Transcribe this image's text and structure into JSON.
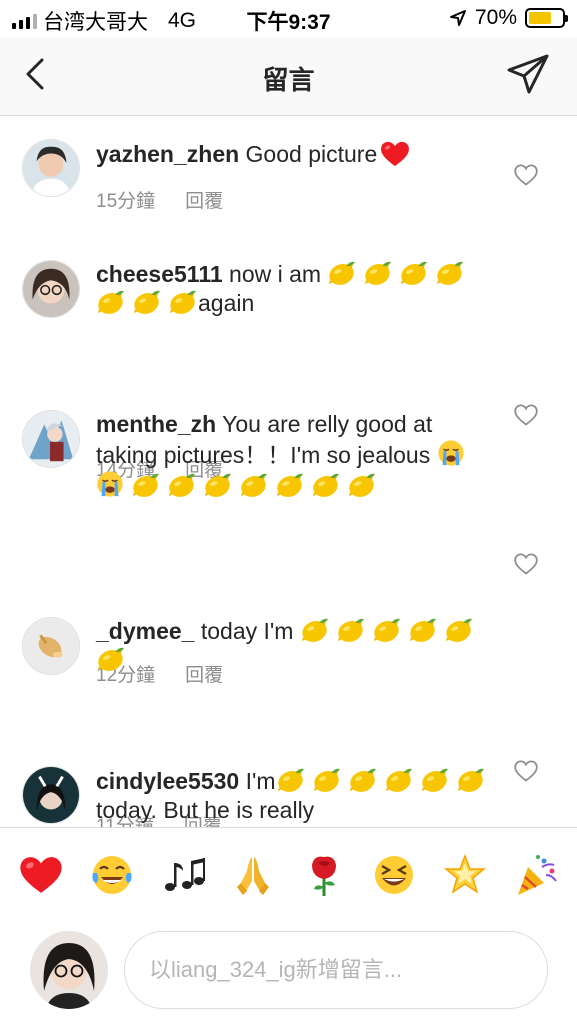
{
  "status_bar": {
    "carrier": "台湾大哥大",
    "network": "4G",
    "time": "下午9:37",
    "battery_percent": 70,
    "battery_label": "70%",
    "icons": [
      "signal-icon",
      "location-arrow-icon",
      "battery-icon"
    ]
  },
  "header": {
    "title": "留言",
    "back_icon": "chevron-left-icon",
    "send_icon": "paper-plane-icon"
  },
  "comments": [
    {
      "username": "yazhen_zhen",
      "text": "Good picture",
      "emoji_after": [
        "red-heart"
      ],
      "time": "15分鐘",
      "reply": "回覆"
    },
    {
      "username": "cheese5111",
      "text": "now  i am",
      "lemons_before_end": 7,
      "text_end": "again",
      "time": "14分鐘",
      "reply": "回覆"
    },
    {
      "username": "menthe_zh",
      "text": "You are relly good at taking pictures！！I'm so jealous",
      "emoji_after": [
        "loudly-crying-face",
        "loudly-crying-face"
      ],
      "lemons": 7,
      "time": "12分鐘",
      "reply": "回覆"
    },
    {
      "username": "_dymee_",
      "text": "today I'm",
      "lemons": 6,
      "time": "11分鐘",
      "reply": "回覆"
    },
    {
      "username": "cindylee5530",
      "text": "I'm",
      "lemons_mid": 6,
      "text_end": "today. But he is really",
      "time": "",
      "reply": ""
    }
  ],
  "emoji_bar": [
    "red-heart",
    "face-with-tears-of-joy",
    "musical-notes",
    "folded-hands",
    "rose",
    "grinning-squinting-face",
    "glowing-star",
    "party-popper"
  ],
  "input": {
    "placeholder": "以liang_324_ig新增留言..."
  },
  "colors": {
    "text": "#262626",
    "meta": "#8e8e8e",
    "header_bg": "#f9f9f9",
    "divider": "#dbdbdb",
    "battery": "#f5c400",
    "heart": "#ed1c24",
    "lemon": "#f7c600"
  }
}
